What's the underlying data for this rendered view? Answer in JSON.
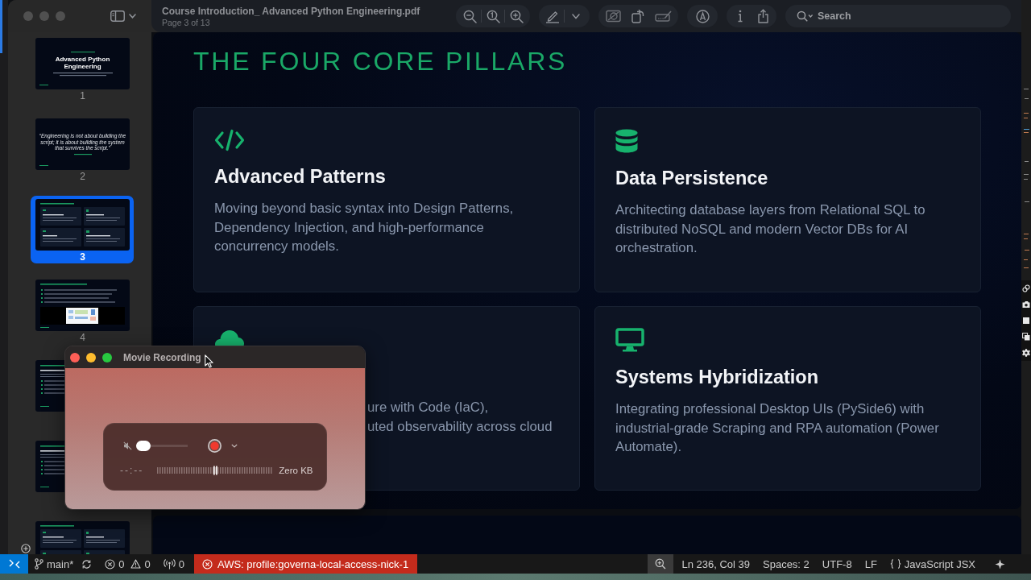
{
  "window": {
    "title": "Course Introduction_ Advanced Python Engineering.pdf",
    "subtitle": "Page 3 of 13"
  },
  "toolbar": {
    "search": {
      "placeholder": "Search"
    }
  },
  "sidebar": {
    "pages": [
      {
        "kind": "title",
        "number": "1",
        "selected": false,
        "title": "Advanced Python Engineering"
      },
      {
        "kind": "quote",
        "number": "2",
        "selected": false,
        "quote": "“Engineering is not about building the script; it is about building the system that survives the script.”"
      },
      {
        "kind": "grid",
        "number": "3",
        "selected": true
      },
      {
        "kind": "diagram",
        "number": "4",
        "selected": false
      },
      {
        "kind": "list",
        "selected": false
      },
      {
        "kind": "list",
        "selected": false
      },
      {
        "kind": "grid",
        "selected": false
      }
    ]
  },
  "slide": {
    "title": "THE FOUR CORE PILLARS",
    "cards": [
      {
        "title": "Advanced Patterns",
        "description": [
          "Moving beyond basic syntax into Design Patterns,",
          "Dependency Injection, and high-performance",
          "concurrency models."
        ]
      },
      {
        "title": "Data Persistence",
        "description": [
          "Architecting database layers from Relational SQL to",
          "distributed NoSQL and modern Vector DBs for AI",
          "orchestration."
        ]
      },
      {
        "description": [
          "ure with Code (IaC),",
          "uted observability across cloud"
        ]
      },
      {
        "title": "Systems Hybridization",
        "description": [
          "Integrating professional Desktop UIs (PySide6) with",
          "industrial-grade Scraping and RPA automation (Power",
          "Automate)."
        ]
      }
    ]
  },
  "recording_window": {
    "title": "Movie Recording",
    "volume": {
      "level": 0
    },
    "elapsed": "--:--",
    "file_size": "Zero KB"
  },
  "status_bar": {
    "branch": "main*",
    "errors": "0",
    "warnings": "0",
    "ports": "0",
    "aws_profile": "AWS: profile:governa-local-access-nick-1",
    "cursor_position": "Ln 236, Col 39",
    "indentation": "Spaces: 2",
    "encoding": "UTF-8",
    "line_ending": "LF",
    "language": "JavaScript JSX"
  }
}
